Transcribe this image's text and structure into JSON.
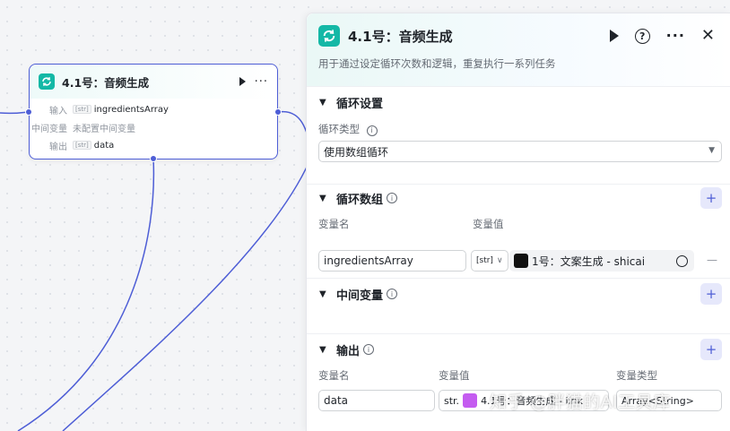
{
  "node": {
    "title": "4.1号：音频生成",
    "rows": [
      {
        "label": "输入",
        "tag": "[str]",
        "value": "ingredientsArray"
      },
      {
        "label": "中间变量",
        "tag": "",
        "value": "未配置中间变量"
      },
      {
        "label": "输出",
        "tag": "[str]",
        "value": "data"
      }
    ]
  },
  "panel": {
    "title": "4.1号：音频生成",
    "description": "用于通过设定循环次数和逻辑，重复执行一系列任务",
    "loop_settings": {
      "title": "循环设置",
      "type_label": "循环类型",
      "type_value": "使用数组循环"
    },
    "loop_array": {
      "title": "循环数组",
      "name_header": "变量名",
      "value_header": "变量值",
      "var_name": "ingredientsArray",
      "var_type": "[str]",
      "ref_value": "1号：文案生成 - shicai"
    },
    "intermediate": {
      "title": "中间变量"
    },
    "output": {
      "title": "输出",
      "name_header": "变量名",
      "value_header": "变量值",
      "type_header": "变量类型",
      "var_name": "data",
      "var_type": "str.",
      "ref_value": "4.1号：音频生成 - link",
      "type_value": "Array<String>"
    }
  },
  "watermark": "知乎 @胖猫的AI工具库",
  "icons": {
    "loop": "loop-icon",
    "play": "play-icon",
    "help": "help-icon",
    "more": "more-icon",
    "close": "close-icon",
    "info": "info-icon",
    "add": "add-icon",
    "chevron": "chevron-down-icon",
    "target": "target-icon"
  },
  "colors": {
    "accent": "#4e5ed6",
    "loop_icon": "#14b8a6",
    "add_bg": "#e6e8fb"
  }
}
